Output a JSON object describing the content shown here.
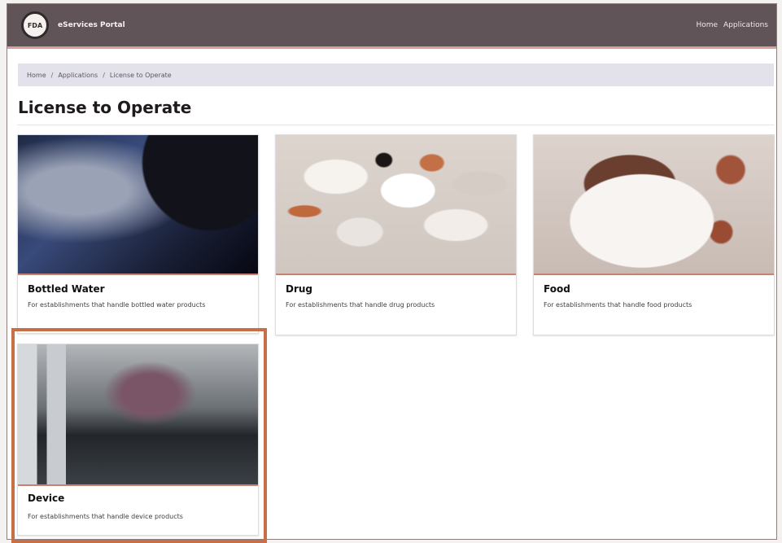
{
  "header": {
    "logo_text": "FDA",
    "brand": "eServices Portal",
    "nav": [
      "Home",
      "Applications"
    ]
  },
  "breadcrumb": [
    "Home",
    "Applications",
    "License to Operate"
  ],
  "page_title": "License to Operate",
  "cards": [
    {
      "title": "Bottled Water",
      "description": "For establishments that handle bottled water products",
      "image": "bottled-water-image"
    },
    {
      "title": "Drug",
      "description": "For establishments that handle drug products",
      "image": "drug-image"
    },
    {
      "title": "Food",
      "description": "For establishments that handle food products",
      "image": "food-image"
    },
    {
      "title": "Device",
      "description": "For establishments that handle device products",
      "image": "device-image"
    }
  ],
  "colors": {
    "navbar": "#615458",
    "breadcrumb_bg": "#e3e1ea",
    "highlight": "#c77048"
  }
}
